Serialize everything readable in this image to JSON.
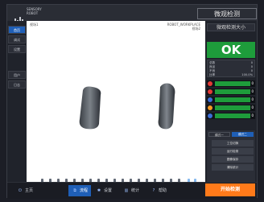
{
  "app": {
    "title": "微观检测",
    "logo_text_line1": "SENSORY",
    "logo_text_line2": "ROBOT"
  },
  "left_nav": {
    "items": [
      {
        "label": "首页"
      },
      {
        "label": "调试"
      },
      {
        "label": "设置"
      },
      {
        "label": "用户"
      },
      {
        "label": "日志"
      }
    ]
  },
  "viewport": {
    "label_tl": "视场1",
    "label_tr_line1": "ROBOT_WORKPLACE",
    "label_tr_line2": "视场2"
  },
  "right": {
    "model_select": "微观检测大小",
    "ok_label": "OK",
    "stats": {
      "line1_left": "总数",
      "line1_right": "0",
      "line2_left": "良品",
      "line2_right": "0",
      "line3_left": "不良",
      "line3_right": "0",
      "line4_left": "比率",
      "line4_right": "100.0%"
    },
    "status_rows": [
      {
        "label": "",
        "value": "0"
      },
      {
        "label": "",
        "value": "0"
      },
      {
        "label": "",
        "value": "0"
      },
      {
        "label": "",
        "value": "0"
      },
      {
        "label": "",
        "value": "0"
      }
    ],
    "tabs": [
      {
        "label": "模式一"
      },
      {
        "label": "模式二"
      }
    ],
    "buttons": [
      {
        "label": "工位切换"
      },
      {
        "label": "运行检测"
      },
      {
        "label": "图像保存"
      },
      {
        "label": "清除统计"
      }
    ],
    "start_button": "开始检测"
  },
  "bottom": {
    "items": [
      {
        "label": "主页",
        "icon": "power-icon"
      },
      {
        "label": "流程",
        "icon": "network-icon"
      },
      {
        "label": "设置",
        "icon": "tools-icon"
      },
      {
        "label": "统计",
        "icon": "chart-icon"
      },
      {
        "label": "帮助",
        "icon": "help-icon"
      }
    ]
  },
  "colors": {
    "ok_green": "#1e9c3b",
    "accent_blue": "#1f5fb7",
    "start_orange": "#ff7a1a"
  }
}
